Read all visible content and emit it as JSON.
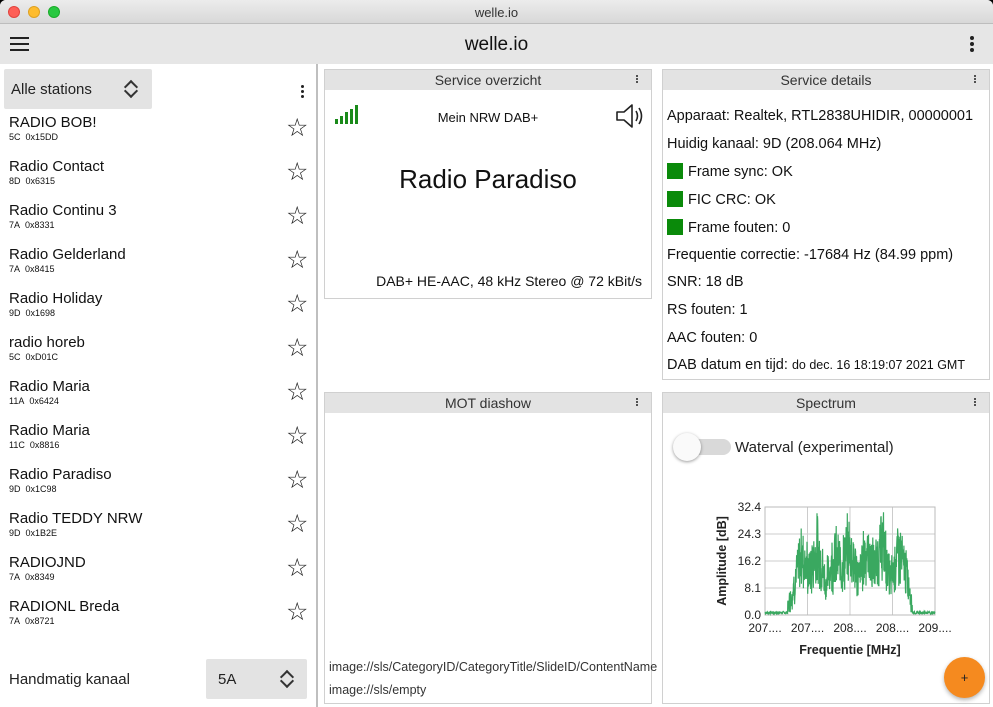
{
  "window": {
    "title": "welle.io"
  },
  "appbar": {
    "title": "welle.io"
  },
  "sidebar": {
    "station_filter": "Alle stations",
    "stations": [
      {
        "name": "RADIO BOB!",
        "channel": "5C",
        "sid": "0x15DD"
      },
      {
        "name": "Radio Contact",
        "channel": "8D",
        "sid": "0x6315"
      },
      {
        "name": "Radio Continu 3",
        "channel": "7A",
        "sid": "0x8331"
      },
      {
        "name": "Radio Gelderland",
        "channel": "7A",
        "sid": "0x8415"
      },
      {
        "name": "Radio Holiday",
        "channel": "9D",
        "sid": "0x1698"
      },
      {
        "name": "radio horeb",
        "channel": "5C",
        "sid": "0xD01C"
      },
      {
        "name": "Radio Maria",
        "channel": "11A",
        "sid": "0x6424"
      },
      {
        "name": "Radio Maria",
        "channel": "11C",
        "sid": "0x8816"
      },
      {
        "name": "Radio Paradiso",
        "channel": "9D",
        "sid": "0x1C98"
      },
      {
        "name": "Radio TEDDY NRW",
        "channel": "9D",
        "sid": "0x1B2E"
      },
      {
        "name": "RADIOJND",
        "channel": "7A",
        "sid": "0x8349"
      },
      {
        "name": "RADIONL Breda",
        "channel": "7A",
        "sid": "0x8721"
      }
    ],
    "manual_channel_label": "Handmatig kanaal",
    "manual_channel_value": "5A"
  },
  "overview": {
    "title": "Service overzicht",
    "ensemble": "Mein NRW DAB+",
    "station": "Radio Paradiso",
    "codec": "DAB+ HE-AAC, 48 kHz Stereo @ 72 kBit/s",
    "signal_bars": 5
  },
  "details": {
    "title": "Service details",
    "device": "Apparaat: Realtek, RTL2838UHIDIR, 00000001",
    "channel": "Huidig kanaal: 9D (208.064 MHz)",
    "frame_sync": "Frame sync: OK",
    "fic_crc": "FIC CRC: OK",
    "frame_errors": "Frame fouten: 0",
    "freq_correction": "Frequentie correctie: -17684 Hz (84.99 ppm)",
    "snr": "SNR: 18 dB",
    "rs_errors": "RS fouten: 1",
    "aac_errors": "AAC fouten: 0",
    "datetime_label": "DAB datum en tijd:",
    "datetime_value": "do dec. 16 18:19:07 2021 GMT",
    "status_color": "#0a8a0a"
  },
  "mot": {
    "title": "MOT diashow",
    "line1": "image://sls/CategoryID/CategoryTitle/SlideID/ContentName",
    "line2": "image://sls/empty"
  },
  "spectrum": {
    "title": "Spectrum",
    "waterfall_label": "Waterval (experimental)",
    "waterfall_enabled": false
  },
  "chart_data": {
    "type": "line",
    "xlabel": "Frequentie [MHz]",
    "ylabel": "Amplitude [dB]",
    "ylim": [
      0,
      32.4
    ],
    "yticks": [
      "0.0",
      "8.1",
      "16.2",
      "24.3",
      "32.4"
    ],
    "xticks": [
      "207....",
      "207....",
      "208....",
      "208....",
      "209...."
    ],
    "xlim": [
      207.0,
      209.1
    ],
    "band": [
      207.28,
      208.82
    ],
    "series_color": "#3aa860",
    "series": [
      {
        "x": [
          207.0,
          207.1,
          207.2,
          207.27,
          207.29,
          207.35,
          207.45,
          207.55,
          207.65,
          207.75,
          207.85,
          207.95,
          208.05,
          208.15,
          208.25,
          208.35,
          208.45,
          208.55,
          208.65,
          208.75,
          208.81,
          208.83,
          208.95,
          209.1
        ],
        "y": [
          0.5,
          0.6,
          0.5,
          0.8,
          4.0,
          12.0,
          27.0,
          18.0,
          30.0,
          14.0,
          26.0,
          22.0,
          31.0,
          16.0,
          29.0,
          20.0,
          32.0,
          15.0,
          28.0,
          18.0,
          6.0,
          1.0,
          0.5,
          0.5
        ]
      }
    ]
  }
}
